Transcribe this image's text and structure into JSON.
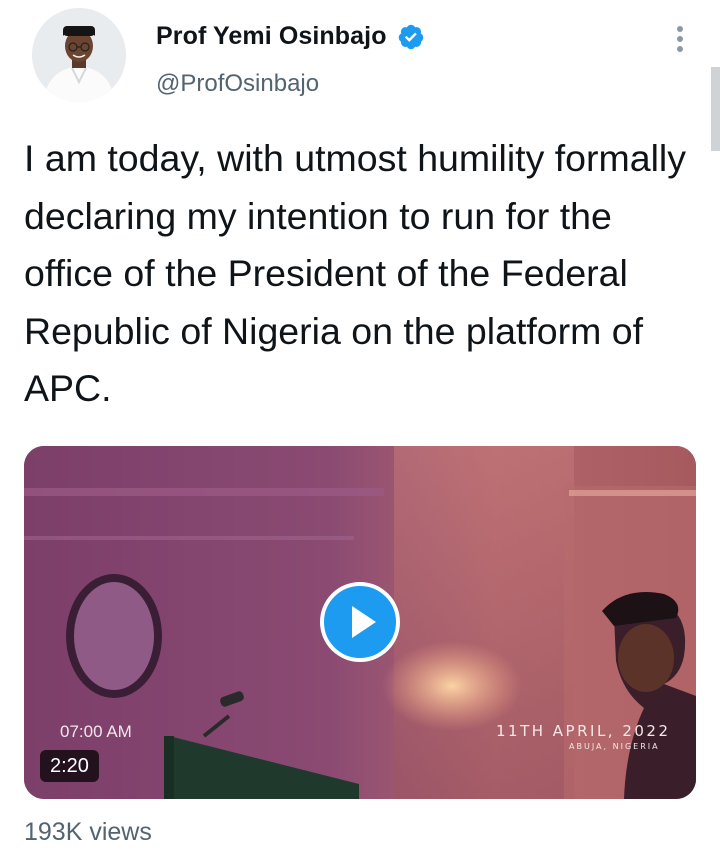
{
  "author": {
    "name": "Prof Yemi Osinbajo",
    "handle": "@ProfOsinbajo",
    "verified": true,
    "avatar_icon": "profile-photo"
  },
  "tweet": {
    "text": "I am today, with utmost humility formally declaring my intention to run for the office of the President of the Federal Republic of Nigeria on the platform of APC."
  },
  "media": {
    "overlay_time": "07:00 AM",
    "overlay_date": "11TH APRIL, 2022",
    "overlay_location": "ABUJA, NIGERIA",
    "duration": "2:20",
    "play_icon": "play-icon"
  },
  "stats": {
    "views": "193K views"
  },
  "colors": {
    "verified": "#1d9bf0",
    "secondary_text": "#536471",
    "primary_text": "#0f1419"
  }
}
